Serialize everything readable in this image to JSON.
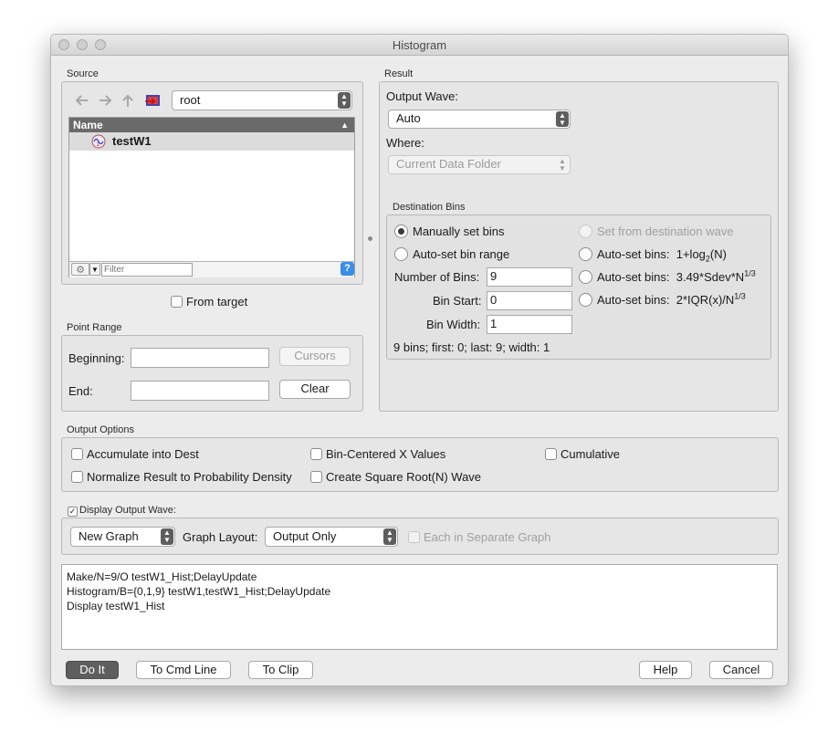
{
  "window": {
    "title": "Histogram"
  },
  "source": {
    "label": "Source",
    "folder": "root",
    "list_header": "Name",
    "items": [
      {
        "name": "testW1"
      }
    ],
    "filter_placeholder": "Filter",
    "from_target_label": "From target"
  },
  "point_range": {
    "label": "Point Range",
    "beginning_label": "Beginning:",
    "beginning_value": "",
    "end_label": "End:",
    "end_value": "",
    "cursors_label": "Cursors",
    "clear_label": "Clear"
  },
  "result": {
    "label": "Result",
    "output_wave_label": "Output Wave:",
    "output_wave_value": "Auto",
    "where_label": "Where:",
    "where_value": "Current Data Folder"
  },
  "destination_bins": {
    "label": "Destination Bins",
    "manual_label": "Manually set bins",
    "auto_range_label": "Auto-set bin range",
    "from_dest_label": "Set from destination wave",
    "auto_bins_label": "Auto-set bins:",
    "formula_log": "1+log",
    "formula_log_sub": "2",
    "formula_log_tail": "(N)",
    "formula_sdev": "3.49*Sdev*N",
    "formula_iqr": "2*IQR(x)/N",
    "formula_exp": "1/3",
    "num_bins_label": "Number of Bins:",
    "num_bins_value": "9",
    "bin_start_label": "Bin Start:",
    "bin_start_value": "0",
    "bin_width_label": "Bin Width:",
    "bin_width_value": "1",
    "summary": "9 bins; first: 0; last: 9; width: 1"
  },
  "output_options": {
    "label": "Output Options",
    "accumulate": "Accumulate into Dest",
    "bin_centered": "Bin-Centered X Values",
    "cumulative": "Cumulative",
    "normalize": "Normalize Result to Probability Density",
    "sqrt_wave": "Create Square Root(N) Wave"
  },
  "display": {
    "label": "Display Output Wave:",
    "graph_value": "New Graph",
    "layout_label": "Graph Layout:",
    "layout_value": "Output Only",
    "separate_label": "Each in Separate Graph"
  },
  "command": {
    "lines": [
      "Make/N=9/O testW1_Hist;DelayUpdate",
      "Histogram/B={0,1,9} testW1,testW1_Hist;DelayUpdate",
      "Display testW1_Hist"
    ]
  },
  "buttons": {
    "do_it": "Do It",
    "to_cmd_line": "To Cmd Line",
    "to_clip": "To Clip",
    "help": "Help",
    "cancel": "Cancel"
  }
}
